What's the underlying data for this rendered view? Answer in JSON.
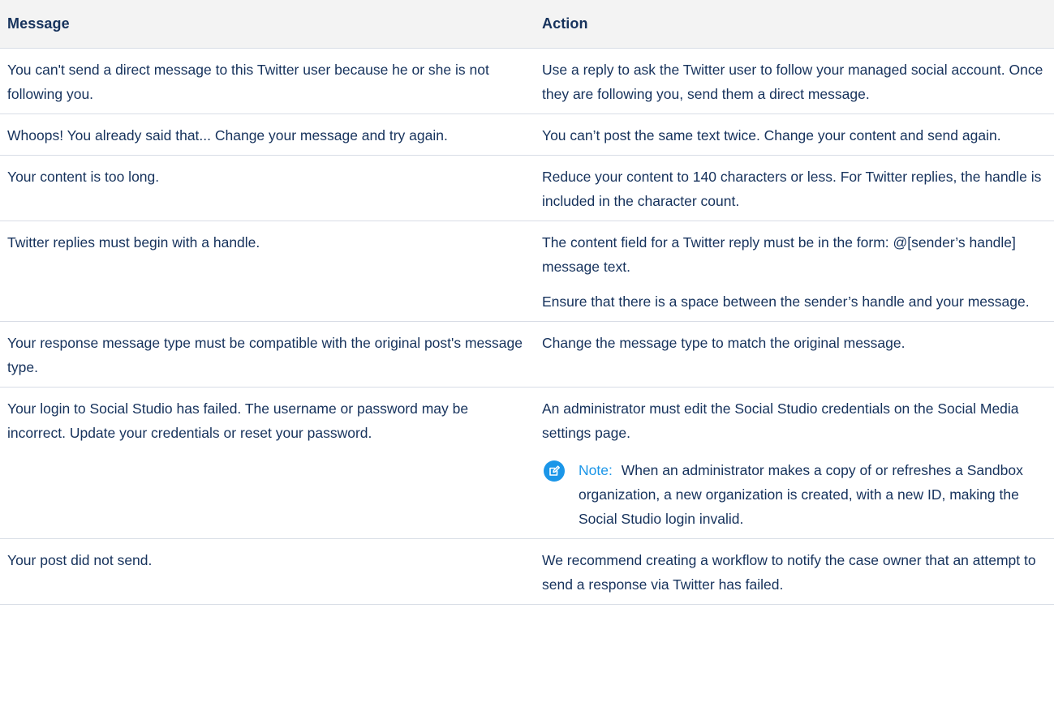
{
  "table": {
    "headers": {
      "message": "Message",
      "action": "Action"
    },
    "rows": [
      {
        "message": "You can't send a direct message to this Twitter user because he or she is not following you.",
        "action": [
          "Use a reply to ask the Twitter user to follow your managed social account. Once they are following you, send them a direct message."
        ]
      },
      {
        "message": "Whoops! You already said that... Change your message and try again.",
        "action": [
          "You can’t post the same text twice. Change your content and send again."
        ]
      },
      {
        "message": "Your content is too long.",
        "action": [
          "Reduce your content to 140 characters or less. For Twitter replies, the handle is included in the character count."
        ]
      },
      {
        "message": "Twitter replies must begin with a handle.",
        "action": [
          "The content field for a Twitter reply must be in the form: @[sender’s handle] message text.",
          "Ensure that there is a space between the sender’s handle and your message."
        ]
      },
      {
        "message": "Your response message type must be compatible with the original post's message type.",
        "action": [
          "Change the message type to match the original message."
        ]
      },
      {
        "message": "Your login to Social Studio has failed. The username or password may be incorrect. Update your credentials or reset your password.",
        "action": [
          "An administrator must edit the Social Studio credentials on the Social Media settings page."
        ],
        "note": {
          "label": "Note:",
          "text": "When an administrator makes a copy of or refreshes a Sandbox organization, a new organization is created, with a new ID, making the Social Studio login invalid.",
          "icon": "note-edit-icon",
          "color": "#1b96e8"
        }
      },
      {
        "message": "Your post did not send.",
        "action": [
          "We recommend creating a workflow to notify the case owner that an attempt to send a response via Twitter has failed."
        ]
      }
    ]
  }
}
